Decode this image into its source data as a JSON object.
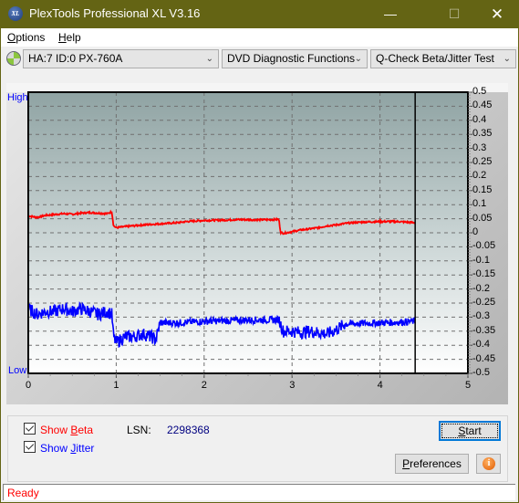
{
  "window": {
    "title": "PlexTools Professional XL V3.16",
    "app_icon": "XL",
    "controls": {
      "minimize": "—",
      "maximize": "☐",
      "close": "✕"
    }
  },
  "menu": [
    {
      "label": "Options",
      "accel": "O",
      "rest": "ptions"
    },
    {
      "label": "Help",
      "accel": "H",
      "rest": "elp"
    }
  ],
  "toolbar": {
    "drive_icon": "disc-icon",
    "drive": "HA:7 ID:0  PX-760A",
    "function": "DVD Diagnostic Functions",
    "test": "Q-Check Beta/Jitter Test"
  },
  "chart_data": {
    "type": "line",
    "title": "",
    "xlabel": "",
    "ylabel": "",
    "left_labels": {
      "high": "High",
      "low": "Low"
    },
    "xlim": [
      0,
      5
    ],
    "ylim": [
      -0.5,
      0.5
    ],
    "x_ticks": [
      "0",
      "1",
      "2",
      "3",
      "4",
      "5"
    ],
    "y_ticks": [
      "0.5",
      "0.45",
      "0.4",
      "0.35",
      "0.3",
      "0.25",
      "0.2",
      "0.15",
      "0.1",
      "0.05",
      "0",
      "-0.05",
      "-0.1",
      "-0.15",
      "-0.2",
      "-0.25",
      "-0.3",
      "-0.35",
      "-0.4",
      "-0.45",
      "-0.5"
    ],
    "grid": true,
    "end_marker_x": 4.4,
    "series": [
      {
        "name": "Beta",
        "color": "#ff0000",
        "x": [
          0,
          0.1,
          0.2,
          0.3,
          0.4,
          0.5,
          0.6,
          0.7,
          0.8,
          0.9,
          0.95,
          0.97,
          1.0,
          1.1,
          1.2,
          1.3,
          1.4,
          1.5,
          1.6,
          1.7,
          1.8,
          1.9,
          2.0,
          2.2,
          2.4,
          2.6,
          2.8,
          2.85,
          2.87,
          2.9,
          3.0,
          3.1,
          3.2,
          3.3,
          3.4,
          3.5,
          3.6,
          3.7,
          3.8,
          4.0,
          4.2,
          4.4
        ],
        "values": [
          0.06,
          0.055,
          0.062,
          0.065,
          0.068,
          0.066,
          0.07,
          0.072,
          0.07,
          0.068,
          0.075,
          0.025,
          0.018,
          0.022,
          0.025,
          0.028,
          0.03,
          0.032,
          0.034,
          0.036,
          0.04,
          0.042,
          0.044,
          0.045,
          0.047,
          0.046,
          0.047,
          0.048,
          0.002,
          -0.002,
          0.004,
          0.01,
          0.014,
          0.018,
          0.025,
          0.028,
          0.033,
          0.036,
          0.038,
          0.04,
          0.04,
          0.036
        ]
      },
      {
        "name": "Jitter",
        "color": "#0000ff",
        "x": [
          0,
          0.1,
          0.2,
          0.3,
          0.4,
          0.5,
          0.6,
          0.7,
          0.8,
          0.9,
          0.95,
          0.97,
          1.0,
          1.1,
          1.2,
          1.3,
          1.4,
          1.45,
          1.5,
          1.7,
          2.0,
          2.3,
          2.6,
          2.85,
          2.9,
          3.0,
          3.1,
          3.2,
          3.3,
          3.4,
          3.5,
          3.6,
          3.8,
          4.0,
          4.2,
          4.4
        ],
        "values": [
          -0.27,
          -0.29,
          -0.28,
          -0.28,
          -0.27,
          -0.28,
          -0.27,
          -0.28,
          -0.29,
          -0.28,
          -0.29,
          -0.37,
          -0.39,
          -0.37,
          -0.37,
          -0.36,
          -0.37,
          -0.38,
          -0.32,
          -0.32,
          -0.315,
          -0.312,
          -0.31,
          -0.31,
          -0.35,
          -0.35,
          -0.355,
          -0.35,
          -0.355,
          -0.36,
          -0.345,
          -0.325,
          -0.322,
          -0.32,
          -0.318,
          -0.315
        ]
      }
    ]
  },
  "controls": {
    "show_beta": {
      "label": "Show Beta",
      "pre": "Show ",
      "accel": "B",
      "post": "eta",
      "checked": true,
      "color": "#ff0000"
    },
    "show_jitter": {
      "label": "Show Jitter",
      "pre": "Show ",
      "accel": "J",
      "post": "itter",
      "checked": true,
      "color": "#0000ff"
    },
    "lsn_label": "LSN:",
    "lsn_value": "2298368",
    "start": {
      "label": "Start",
      "accel": "S",
      "rest": "tart"
    },
    "preferences": {
      "label": "Preferences",
      "accel": "P",
      "rest": "references"
    },
    "info_icon": "i"
  },
  "status": {
    "text": "Ready"
  }
}
